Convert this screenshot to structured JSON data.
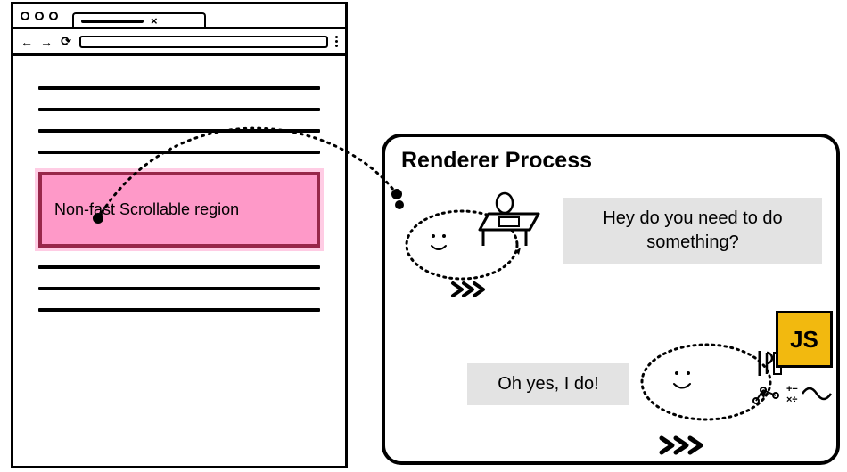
{
  "browser": {
    "region_label": "Non-fast Scrollable region"
  },
  "panel": {
    "title": "Renderer Process",
    "bubble1": "Hey do you need to do something?",
    "bubble2": "Oh yes, I do!",
    "js_label": "JS"
  }
}
